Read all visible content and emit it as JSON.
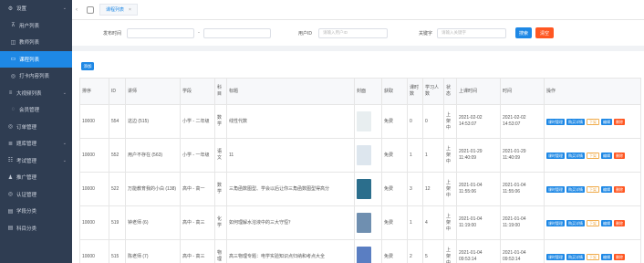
{
  "sidebar": {
    "items": [
      {
        "icon": "⚙",
        "label": "设置",
        "chev": "⌄",
        "active": false,
        "sub": false
      },
      {
        "icon": "⊼",
        "label": "用户列表",
        "active": false,
        "sub": true
      },
      {
        "icon": "◫",
        "label": "教师列表",
        "active": false,
        "sub": true
      },
      {
        "icon": "▭",
        "label": "课程列表",
        "active": true,
        "sub": true
      },
      {
        "icon": "◎",
        "label": "打卡内容列表",
        "active": false,
        "sub": true
      },
      {
        "icon": "≡",
        "label": "大视频列表",
        "chev": "⌄",
        "active": false,
        "sub": false
      },
      {
        "icon": "◌",
        "label": "会员管理",
        "active": false,
        "sub": true
      },
      {
        "icon": "◎",
        "label": "订单管理",
        "active": false,
        "sub": false
      },
      {
        "icon": "≣",
        "label": "题库管理",
        "chev": "⌄",
        "active": false,
        "sub": false
      },
      {
        "icon": "☷",
        "label": "考试管理",
        "chev": "⌄",
        "active": false,
        "sub": false
      },
      {
        "icon": "♟",
        "label": "推广管理",
        "active": false,
        "sub": false
      },
      {
        "icon": "◎",
        "label": "认证管理",
        "active": false,
        "sub": false
      },
      {
        "icon": "▤",
        "label": "学段分类",
        "active": false,
        "sub": false
      },
      {
        "icon": "▤",
        "label": "科目分类",
        "active": false,
        "sub": false
      }
    ]
  },
  "tabs": [
    {
      "label": "课程列表",
      "close": "×"
    }
  ],
  "tabnav": {
    "left": "‹",
    "right": "›"
  },
  "filter": {
    "time_label": "发布时间",
    "date_sep": "-",
    "user_label": "用户ID",
    "user_placeholder": "请输入用户ID",
    "kw_label": "关键字",
    "kw_placeholder": "请输入关键字",
    "search": "搜索",
    "reset": "清空"
  },
  "add_label": "添加",
  "columns": [
    "排序",
    "ID",
    "讲师",
    "学段",
    "科目",
    "标题",
    "封面",
    "获取",
    "课时数",
    "学习人数",
    "状态",
    "上课时间",
    "时间",
    "操作"
  ],
  "rows": [
    {
      "sort": "10000",
      "id": "554",
      "teacher": "这边 (515)",
      "stage": "小学 - 二年级",
      "subject": "数学",
      "title": "线性代数",
      "cover": "#e8eef0",
      "get": "免费",
      "hours": "0",
      "learners": "0",
      "status": "上架中",
      "class_time": "2021-02-02 14:53:07",
      "time": "2021-02-02 14:53:07"
    },
    {
      "sort": "10000",
      "id": "552",
      "teacher": "用户不存在 (563)",
      "stage": "小学 - 一年级",
      "subject": "语文",
      "title": "11",
      "cover": "#dde6ee",
      "get": "免费",
      "hours": "1",
      "learners": "1",
      "status": "上架中",
      "class_time": "2021-01-29 11:40:09",
      "time": "2021-01-29 11:40:09"
    },
    {
      "sort": "10000",
      "id": "522",
      "teacher": "万能教育我的小白 (138)",
      "stage": "高中 - 高一",
      "subject": "数学",
      "title": "三角函数图型、学会以后让你三角函数图型得高分",
      "cover": "#2b6e8c",
      "get": "免费",
      "hours": "3",
      "learners": "12",
      "status": "上架中",
      "class_time": "2021-01-04 11:55:06",
      "time": "2021-01-04 11:55:06"
    },
    {
      "sort": "10000",
      "id": "519",
      "teacher": "钟老师 (6)",
      "stage": "高中 - 高三",
      "subject": "化学",
      "title": "如何理解水溶液中的三大守恒？",
      "cover": "#6f8fb0",
      "get": "免费",
      "hours": "1",
      "learners": "4",
      "status": "上架中",
      "class_time": "2021-01-04 11:19:00",
      "time": "2021-01-04 11:19:00"
    },
    {
      "sort": "10000",
      "id": "515",
      "teacher": "陈老师 (7)",
      "stage": "高中 - 高三",
      "subject": "物理",
      "title": "高三物理专题：电学实验知识点归纳和考点大全",
      "cover": "#5a7ec2",
      "get": "免费",
      "hours": "2",
      "learners": "5",
      "status": "上架中",
      "class_time": "2021-01-04 09:53:14",
      "time": "2021-01-04 09:53:14"
    }
  ],
  "ops": {
    "lesson": "课时管理",
    "buy": "购买详情",
    "off": "下架",
    "edit": "编辑",
    "del": "删除"
  },
  "colors": {
    "sidebar": "#2f3d52",
    "accent": "#1e88e5",
    "danger": "#ff5722",
    "warn": "#f0ad4e"
  }
}
